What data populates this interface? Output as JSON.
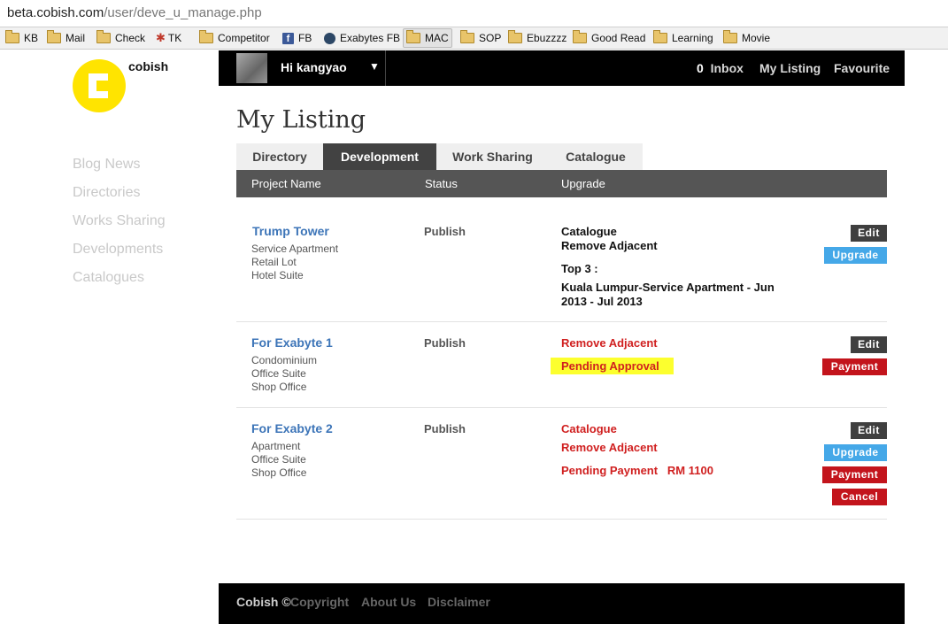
{
  "browser": {
    "url_host": "beta.cobish.com",
    "url_path": "/user/deve_u_manage.php",
    "bookmarks": [
      {
        "label": "KB",
        "icon": "folder-icon"
      },
      {
        "label": "Mail",
        "icon": "folder-icon"
      },
      {
        "label": "Check",
        "icon": "folder-icon"
      },
      {
        "label": "TK",
        "icon": "bug-icon"
      },
      {
        "label": "Competitor",
        "icon": "folder-icon"
      },
      {
        "label": "FB",
        "icon": "facebook-icon"
      },
      {
        "label": "Exabytes FB",
        "icon": "exabytes-icon"
      },
      {
        "label": "MAC",
        "icon": "folder-icon"
      },
      {
        "label": "SOP",
        "icon": "folder-icon"
      },
      {
        "label": "Ebuzzzz",
        "icon": "folder-icon"
      },
      {
        "label": "Good Read",
        "icon": "folder-icon"
      },
      {
        "label": "Learning",
        "icon": "folder-icon"
      },
      {
        "label": "Movie",
        "icon": "folder-icon"
      }
    ],
    "fb_glyph": "f"
  },
  "site": {
    "brand": "cobish",
    "logo_color": "#ffe400",
    "sidebar": [
      "Blog News",
      "Directories",
      "Works Sharing",
      "Developments",
      "Catalogues"
    ]
  },
  "topbar": {
    "greeting": "Hi kangyao",
    "caret": "▼",
    "inbox_count": "0",
    "inbox_label": "Inbox",
    "my_listing": "My Listing",
    "favourite": "Favourite"
  },
  "page": {
    "title": "My Listing",
    "tabs": [
      "Directory",
      "Development",
      "Work Sharing",
      "Catalogue"
    ],
    "active_tab": "Development",
    "columns": [
      "Project Name",
      "Status",
      "Upgrade"
    ]
  },
  "rows": [
    {
      "name": "Trump Tower",
      "types": [
        "Service Apartment",
        "Retail Lot",
        "Hotel Suite"
      ],
      "status": "Publish",
      "upgrades": [
        "Catalogue",
        "Remove Adjacent"
      ],
      "top_label": "Top 3 :",
      "top_detail": "Kuala Lumpur-Service Apartment - Jun 2013 - Jul 2013",
      "buttons": [
        "Edit",
        "Upgrade"
      ]
    },
    {
      "name": "For Exabyte 1",
      "types": [
        "Condominium",
        "Office Suite",
        "Shop Office"
      ],
      "status": "Publish",
      "upgrades": [
        "Remove Adjacent"
      ],
      "pending": "Pending Approval",
      "buttons": [
        "Edit",
        "Payment"
      ]
    },
    {
      "name": "For Exabyte 2",
      "types": [
        "Apartment",
        "Office Suite",
        "Shop Office"
      ],
      "status": "Publish",
      "upgrades": [
        "Catalogue",
        "Remove Adjacent"
      ],
      "pending": "Pending Payment",
      "amount": "RM 1100",
      "buttons": [
        "Edit",
        "Upgrade",
        "Payment",
        "Cancel"
      ]
    }
  ],
  "footer": {
    "brand": "Cobish ©",
    "copyright": "Copyright",
    "about": "About Us",
    "disclaimer": "Disclaimer"
  }
}
